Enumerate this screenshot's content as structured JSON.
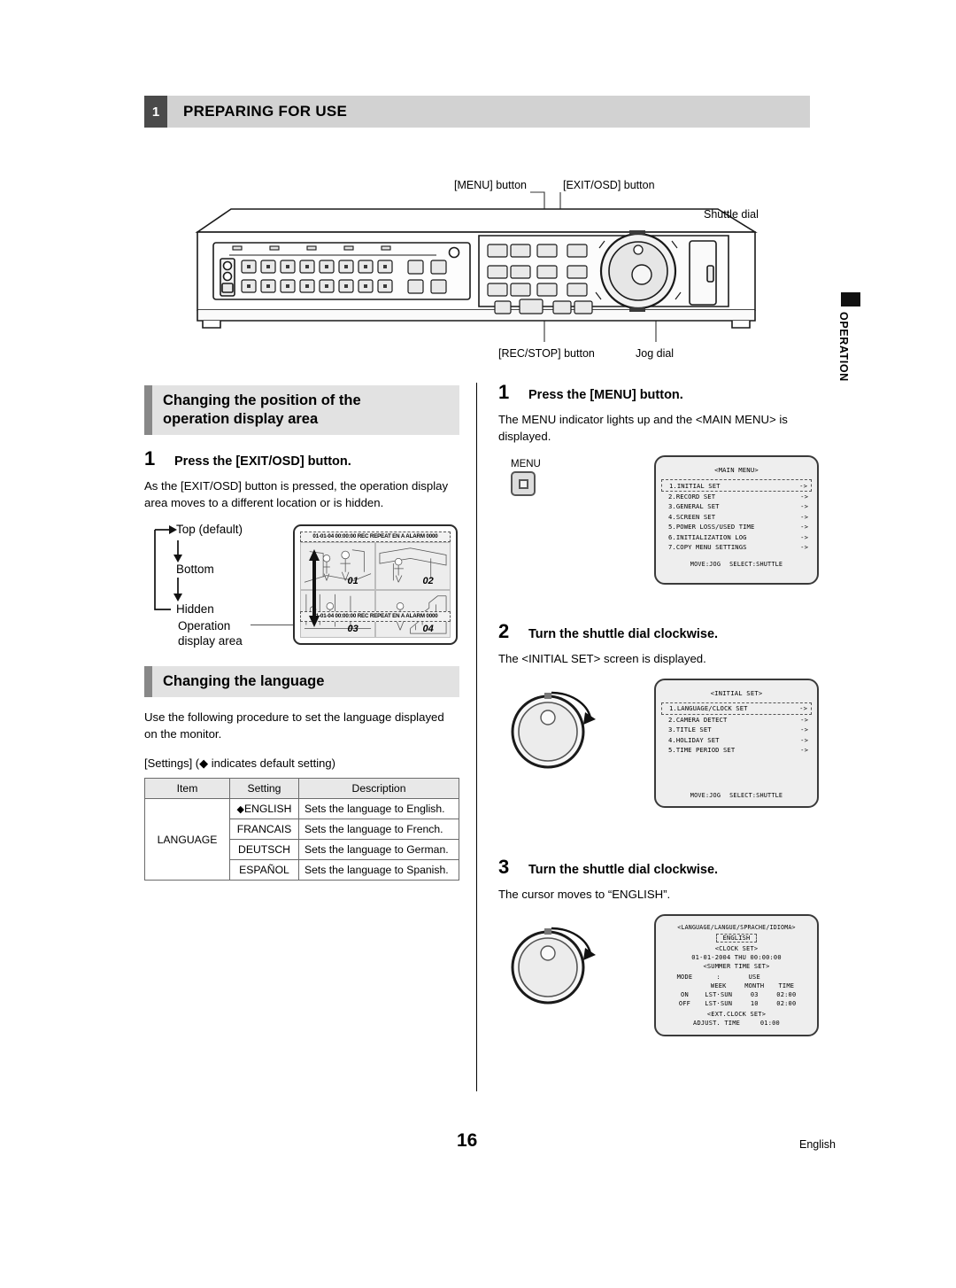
{
  "chapter": {
    "number": "1",
    "title": "PREPARING FOR USE"
  },
  "side_tab": {
    "label": "OPERATION"
  },
  "device_callouts": {
    "menu_button": "[MENU] button",
    "exit_osd_button": "[EXIT/OSD] button",
    "shuttle_dial": "Shuttle dial",
    "rec_stop_button": "[REC/STOP] button",
    "jog_dial": "Jog dial"
  },
  "left_column": {
    "section1": {
      "heading": "Changing the position of the\noperation display area",
      "step": {
        "number": "1",
        "title": "Press the [EXIT/OSD] button."
      },
      "body": "As the [EXIT/OSD] button is pressed, the operation display area moves to a different location or is hidden.",
      "flow": [
        "Top (default)",
        "Bottom",
        "Hidden"
      ],
      "operation_area_label": "Operation\ndisplay area",
      "monitor": {
        "osd_text": "01-01-04 00:00:00 REC REPEAT EN A ALARM 0000",
        "camera_numbers": [
          "01",
          "02",
          "03",
          "04"
        ]
      }
    },
    "section2": {
      "heading": "Changing the language",
      "body": "Use the following procedure to set the language displayed on the monitor.",
      "settings_note": "[Settings] (◆ indicates default setting)",
      "table": {
        "headers": [
          "Item",
          "Setting",
          "Description"
        ],
        "item": "LANGUAGE",
        "rows": [
          {
            "setting": "ENGLISH",
            "default": true,
            "description": "Sets the language to English."
          },
          {
            "setting": "FRANCAIS",
            "default": false,
            "description": "Sets the language to French."
          },
          {
            "setting": "DEUTSCH",
            "default": false,
            "description": "Sets the language to German."
          },
          {
            "setting": "ESPAÑOL",
            "default": false,
            "description": "Sets the language to Spanish."
          }
        ]
      }
    }
  },
  "right_column": {
    "step1": {
      "number": "1",
      "title": "Press the [MENU] button.",
      "body": "The MENU indicator lights up and the <MAIN MENU> is displayed.",
      "button_label": "MENU",
      "screen": {
        "title": "<MAIN MENU>",
        "items": [
          {
            "label": "1.INITIAL SET",
            "arrow": "->",
            "selected": true
          },
          {
            "label": "2.RECORD SET",
            "arrow": "->",
            "selected": false
          },
          {
            "label": "3.GENERAL SET",
            "arrow": "->",
            "selected": false
          },
          {
            "label": "4.SCREEN SET",
            "arrow": "->",
            "selected": false
          },
          {
            "label": "5.POWER LOSS/USED TIME",
            "arrow": "->",
            "selected": false
          },
          {
            "label": "6.INITIALIZATION LOG",
            "arrow": "->",
            "selected": false
          },
          {
            "label": "7.COPY MENU SETTINGS",
            "arrow": "->",
            "selected": false
          }
        ],
        "footer_move": "MOVE:JOG",
        "footer_select": "SELECT:SHUTTLE"
      }
    },
    "step2": {
      "number": "2",
      "title": "Turn the shuttle dial clockwise.",
      "body": "The <INITIAL SET> screen is displayed.",
      "screen": {
        "title": "<INITIAL SET>",
        "items": [
          {
            "label": "1.LANGUAGE/CLOCK SET",
            "arrow": "->",
            "selected": true
          },
          {
            "label": "2.CAMERA DETECT",
            "arrow": "->",
            "selected": false
          },
          {
            "label": "3.TITLE SET",
            "arrow": "->",
            "selected": false
          },
          {
            "label": "4.HOLIDAY SET",
            "arrow": "->",
            "selected": false
          },
          {
            "label": "5.TIME PERIOD SET",
            "arrow": "->",
            "selected": false
          }
        ],
        "footer_move": "MOVE:JOG",
        "footer_select": "SELECT:SHUTTLE"
      }
    },
    "step3": {
      "number": "3",
      "title": "Turn the shuttle dial clockwise.",
      "body": "The cursor moves to “ENGLISH”.",
      "screen": {
        "title": "<LANGUAGE/LANGUE/SPRACHE/IDIOMA>",
        "selected_language": "ENGLISH",
        "clock_set_title": "<CLOCK SET>",
        "clock_value": "01-01-2004 THU 00:00:00",
        "summer_time_title": "<SUMMER TIME SET>",
        "mode_label": "MODE",
        "mode_colon": ":",
        "mode_value": "USE",
        "col_headers": [
          "WEEK",
          "MONTH",
          "TIME"
        ],
        "rows": [
          {
            "state": "ON",
            "week": "LST·SUN",
            "month": "03",
            "time": "02:00"
          },
          {
            "state": "OFF",
            "week": "LST·SUN",
            "month": "10",
            "time": "02:00"
          }
        ],
        "ext_clock_title": "<EXT.CLOCK SET>",
        "adjust_label": "ADJUST. TIME",
        "adjust_value": "01:00"
      }
    }
  },
  "footer": {
    "page_number": "16",
    "language": "English"
  }
}
